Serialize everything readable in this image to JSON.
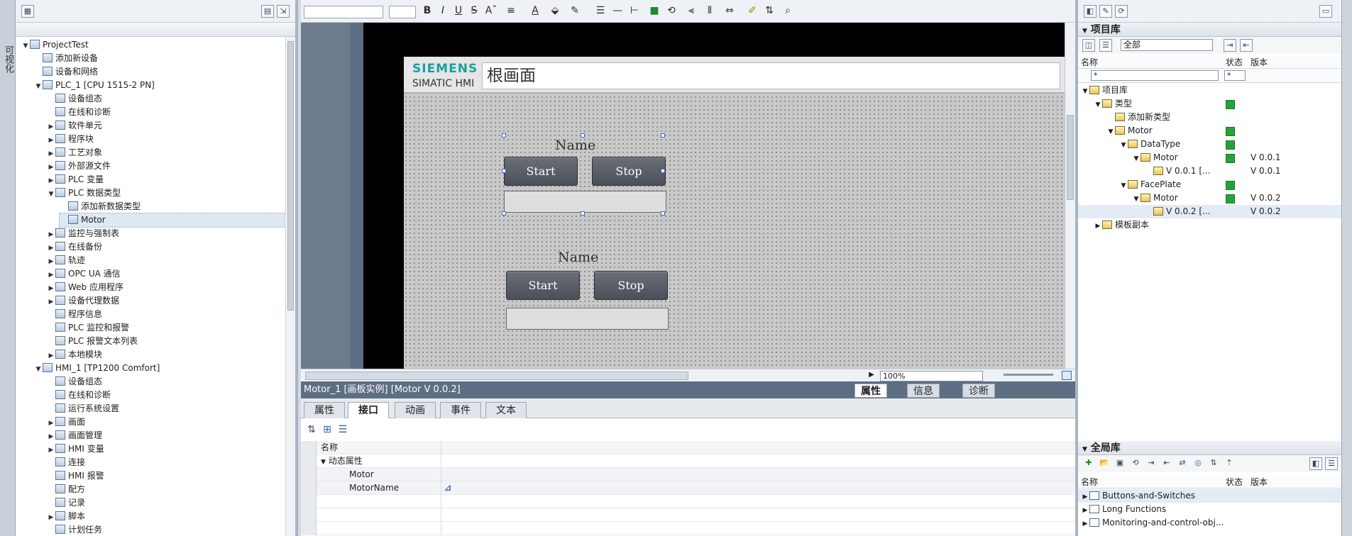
{
  "left_tab": {
    "label": "可视化"
  },
  "project_tree": {
    "rows": [
      {
        "label": "ProjectTest",
        "arrow": "▼"
      },
      {
        "label": "添加新设备",
        "arrow": ""
      },
      {
        "label": "设备和网络",
        "arrow": ""
      },
      {
        "label": "PLC_1 [CPU 1515-2 PN]",
        "arrow": "▼"
      },
      {
        "label": "设备组态",
        "arrow": ""
      },
      {
        "label": "在线和诊断",
        "arrow": ""
      },
      {
        "label": "软件单元",
        "arrow": "▶"
      },
      {
        "label": "程序块",
        "arrow": "▶"
      },
      {
        "label": "工艺对象",
        "arrow": "▶"
      },
      {
        "label": "外部源文件",
        "arrow": "▶"
      },
      {
        "label": "PLC 变量",
        "arrow": "▶"
      },
      {
        "label": "PLC 数据类型",
        "arrow": "▼"
      },
      {
        "label": "添加新数据类型",
        "arrow": ""
      },
      {
        "label": "Motor",
        "arrow": ""
      },
      {
        "label": "监控与强制表",
        "arrow": "▶"
      },
      {
        "label": "在线备份",
        "arrow": "▶"
      },
      {
        "label": "轨迹",
        "arrow": "▶"
      },
      {
        "label": "OPC UA 通信",
        "arrow": "▶"
      },
      {
        "label": "Web 应用程序",
        "arrow": "▶"
      },
      {
        "label": "设备代理数据",
        "arrow": "▶"
      },
      {
        "label": "程序信息",
        "arrow": ""
      },
      {
        "label": "PLC 监控和报警",
        "arrow": ""
      },
      {
        "label": "PLC 报警文本列表",
        "arrow": ""
      },
      {
        "label": "本地模块",
        "arrow": "▶"
      },
      {
        "label": "HMI_1 [TP1200 Comfort]",
        "arrow": "▼"
      },
      {
        "label": "设备组态",
        "arrow": ""
      },
      {
        "label": "在线和诊断",
        "arrow": ""
      },
      {
        "label": "运行系统设置",
        "arrow": ""
      },
      {
        "label": "画面",
        "arrow": "▶"
      },
      {
        "label": "画面管理",
        "arrow": "▶"
      },
      {
        "label": "HMI 变量",
        "arrow": "▶"
      },
      {
        "label": "连接",
        "arrow": ""
      },
      {
        "label": "HMI 报警",
        "arrow": ""
      },
      {
        "label": "配方",
        "arrow": ""
      },
      {
        "label": "记录",
        "arrow": ""
      },
      {
        "label": "脚本",
        "arrow": "▶"
      },
      {
        "label": "计划任务",
        "arrow": ""
      }
    ]
  },
  "format_toolbar": {
    "bold": "B",
    "italic": "I",
    "underline": "U",
    "strike": "S",
    "font_size": "Aˆ",
    "align": "≡",
    "font_color": "A",
    "fill": "⬙",
    "line": "✎"
  },
  "hmi": {
    "logo": "SIEMENS",
    "subtitle": "SIMATIC HMI",
    "screen_title": "根画面",
    "faceplates": [
      {
        "name": "Name",
        "start": "Start",
        "stop": "Stop"
      },
      {
        "name": "Name",
        "start": "Start",
        "stop": "Stop"
      }
    ]
  },
  "canvas": {
    "zoom": "100%"
  },
  "properties": {
    "title": "Motor_1 [画板实例] [Motor V 0.0.2]",
    "right_tabs": [
      "属性",
      "信息",
      "诊断"
    ],
    "tabs": [
      "属性",
      "接口",
      "动画",
      "事件",
      "文本"
    ],
    "active_tab": "接口",
    "column_name": "名称",
    "group": "动态属性",
    "items": [
      "Motor",
      "MotorName"
    ]
  },
  "project_library": {
    "title": "项目库",
    "filter_value": "全部",
    "columns": {
      "name": "名称",
      "status": "状态",
      "version": "版本"
    },
    "filter_row": {
      "name": "*",
      "status": "*"
    },
    "rows": [
      {
        "label": "项目库",
        "arrow": "▼",
        "status": false,
        "version": ""
      },
      {
        "label": "类型",
        "arrow": "▼",
        "status": true,
        "version": ""
      },
      {
        "label": "添加新类型",
        "arrow": "",
        "status": false,
        "version": ""
      },
      {
        "label": "Motor",
        "arrow": "▼",
        "status": true,
        "version": ""
      },
      {
        "label": "DataType",
        "arrow": "▼",
        "status": true,
        "version": ""
      },
      {
        "label": "Motor",
        "arrow": "▼",
        "status": true,
        "version": "V 0.0.1"
      },
      {
        "label": "V 0.0.1 [...",
        "arrow": "",
        "status": false,
        "version": "V 0.0.1"
      },
      {
        "label": "FacePlate",
        "arrow": "▼",
        "status": true,
        "version": ""
      },
      {
        "label": "Motor",
        "arrow": "▼",
        "status": true,
        "version": "V 0.0.2"
      },
      {
        "label": "V 0.0.2 [...",
        "arrow": "",
        "status": false,
        "version": "V 0.0.2"
      },
      {
        "label": "模板副本",
        "arrow": "▶",
        "status": false,
        "version": ""
      }
    ]
  },
  "global_library": {
    "title": "全局库",
    "columns": {
      "name": "名称",
      "status": "状态",
      "version": "版本"
    },
    "rows": [
      {
        "label": "Buttons-and-Switches"
      },
      {
        "label": "Long Functions"
      },
      {
        "label": "Monitoring-and-control-obj..."
      }
    ]
  }
}
